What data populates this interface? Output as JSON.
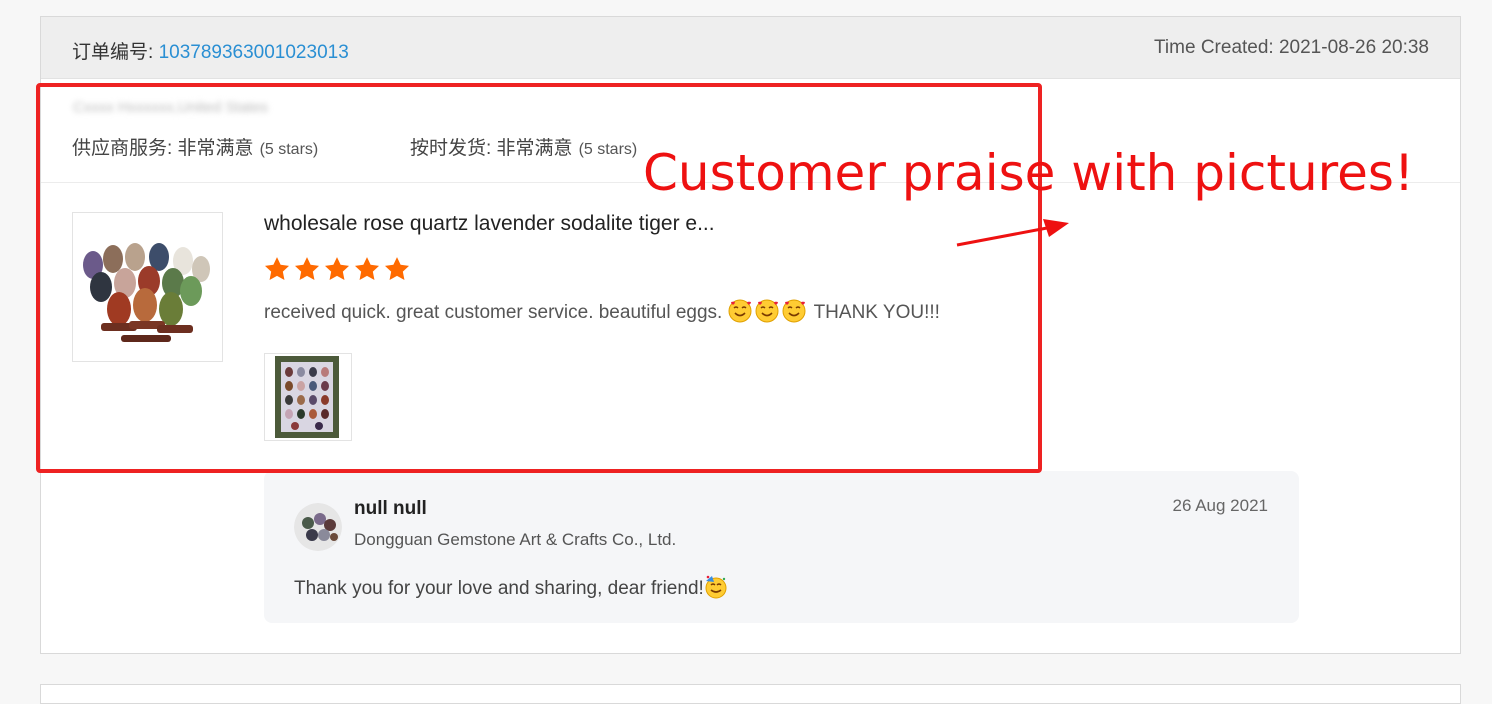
{
  "order": {
    "label": "订单编号: ",
    "number": "103789363001023013",
    "time_created": "Time Created: 2021-08-26 20:38"
  },
  "buyer": {
    "location_blurred": "Cxxxx Hxxxxxx,United States"
  },
  "ratings": {
    "supplier_service_label": "供应商服务: 非常满意",
    "supplier_service_stars": "(5 stars)",
    "on_time_label": "按时发货: 非常满意",
    "on_time_stars": "(5 stars)"
  },
  "review": {
    "product_title": "wholesale rose quartz lavender sodalite tiger e...",
    "rating": 5,
    "text": "received quick. great customer service. beautiful eggs.",
    "text_suffix": "THANK YOU!!!",
    "star_color": "#ff6a00"
  },
  "reply": {
    "name": "null null",
    "company": "Dongguan Gemstone Art & Crafts Co., Ltd.",
    "date": "26 Aug 2021",
    "text": "Thank you for your love and sharing, dear friend!"
  },
  "annotation": {
    "text": "Customer praise with pictures!",
    "color": "#ee1111"
  }
}
